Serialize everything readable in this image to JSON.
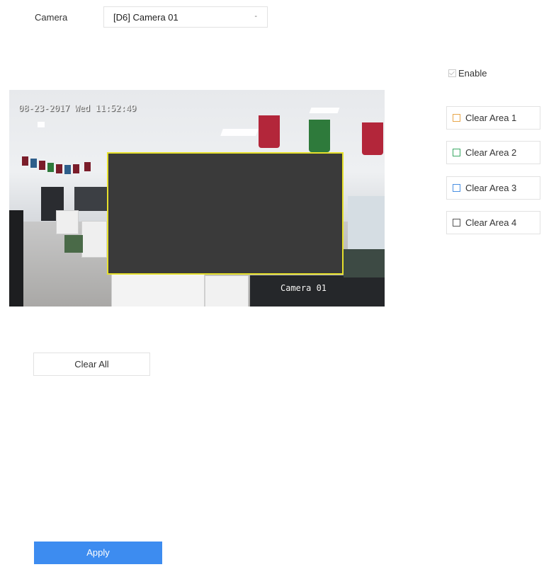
{
  "camera": {
    "label": "Camera",
    "selected_value": "[D6] Camera 01",
    "dropdown_arrow": "-"
  },
  "enable": {
    "label": "Enable",
    "checked": true
  },
  "clear_areas": [
    {
      "label": "Clear Area 1",
      "color": "#e8a64a"
    },
    {
      "label": "Clear Area 2",
      "color": "#3aa864"
    },
    {
      "label": "Clear Area 3",
      "color": "#4a90e2"
    },
    {
      "label": "Clear Area 4",
      "color": "#555555"
    }
  ],
  "video": {
    "osd_timestamp": "08-23-2017 Wed 11:52:49",
    "osd_camera_name": "Camera 01",
    "mask_color": "#e6e02c"
  },
  "buttons": {
    "clear_all": "Clear All",
    "apply": "Apply"
  }
}
